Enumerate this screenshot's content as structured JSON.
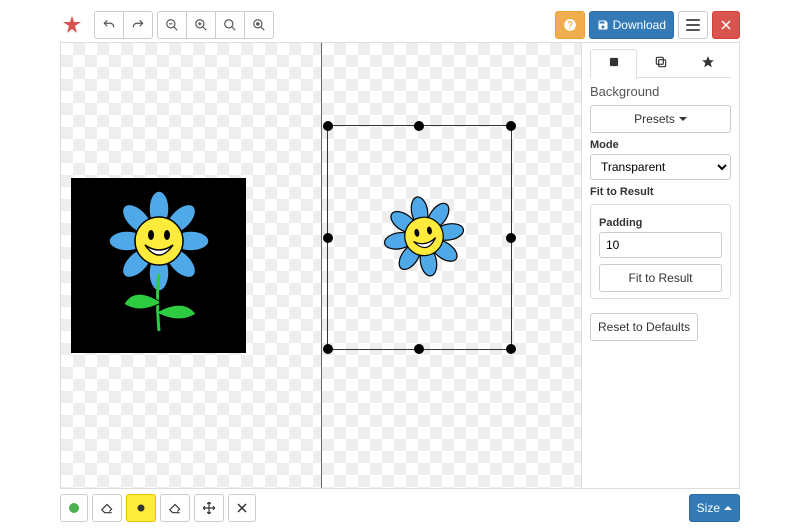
{
  "topbar": {
    "download_label": "Download"
  },
  "sidebar": {
    "title": "Background",
    "presets_label": "Presets",
    "mode_label": "Mode",
    "mode_value": "Transparent",
    "fit_title": "Fit to Result",
    "padding_label": "Padding",
    "padding_value": "10",
    "fit_button": "Fit to Result",
    "reset_label": "Reset to Defaults"
  },
  "bottombar": {
    "size_label": "Size"
  }
}
